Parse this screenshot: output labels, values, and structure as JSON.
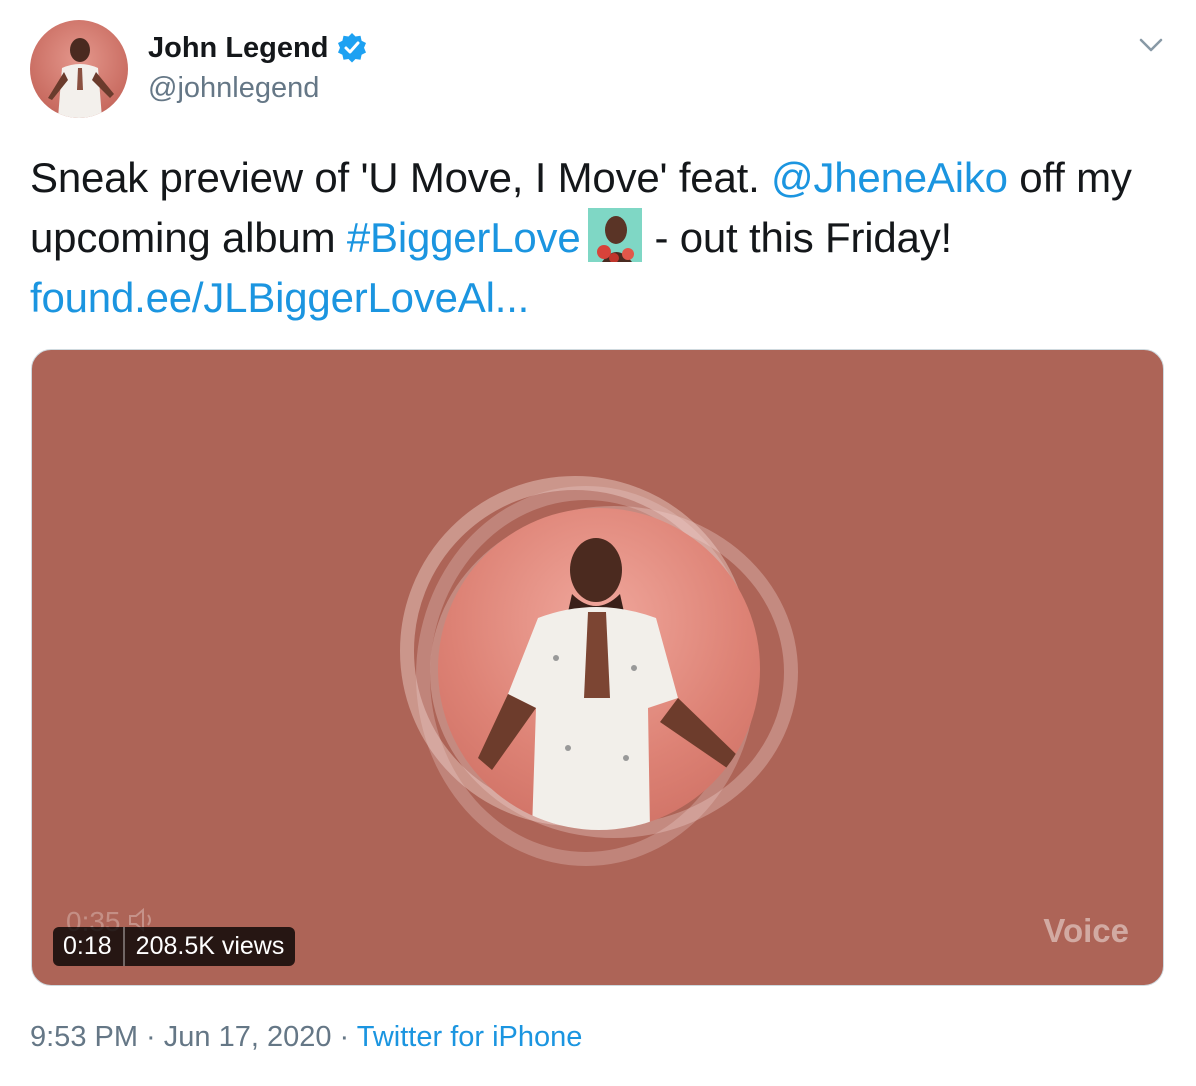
{
  "author": {
    "display_name": "John Legend",
    "handle": "@johnlegend",
    "verified": true
  },
  "tweet": {
    "text_part1": "Sneak preview of 'U Move, I Move' feat. ",
    "mention": "@JheneAiko",
    "text_part2": " off my upcoming album ",
    "hashtag": "#BiggerLove",
    "text_part3": "- out this Friday!",
    "link": "found.ee/JLBiggerLoveAl..."
  },
  "media": {
    "elapsed_time": "0:18",
    "views": "208.5K views",
    "ghost_time": "0:35",
    "watermark": "Voice",
    "background_color": "#ad6457"
  },
  "meta": {
    "time": "9:53 PM",
    "separator": " · ",
    "date": "Jun 17, 2020",
    "source": "Twitter for iPhone"
  },
  "icons": {
    "menu": "chevron-down-icon",
    "verified": "verified-badge-icon",
    "volume": "speaker-icon"
  },
  "colors": {
    "link": "#1b95e0",
    "text": "#14171a",
    "secondary": "#657786"
  }
}
